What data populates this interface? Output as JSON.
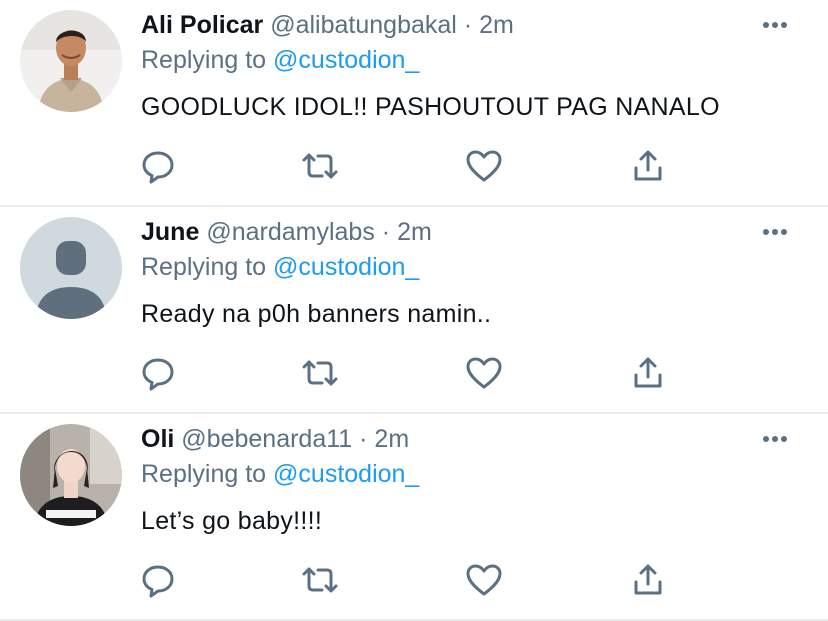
{
  "tweets": [
    {
      "name": "Ali Policar",
      "handle": "@alibatungbakal",
      "separator": "·",
      "time": "2m",
      "replying_prefix": "Replying to",
      "replying_to": "@custodion_",
      "text": "GOODLUCK IDOL!! PASHOUTOUT PAG NANALO",
      "avatar": "profile-photo-man"
    },
    {
      "name": "June",
      "handle": "@nardamylabs",
      "separator": "·",
      "time": "2m",
      "replying_prefix": "Replying to",
      "replying_to": "@custodion_",
      "text": "Ready na p0h banners namin..",
      "avatar": "default-avatar"
    },
    {
      "name": "Oli",
      "handle": "@bebenarda11",
      "separator": "·",
      "time": "2m",
      "replying_prefix": "Replying to",
      "replying_to": "@custodion_",
      "text": "Let’s go baby!!!!",
      "avatar": "profile-photo-woman"
    }
  ],
  "icons": {
    "reply": "comment-icon",
    "retweet": "retweet-icon",
    "like": "heart-icon",
    "share": "share-icon",
    "more": "more-options-icon"
  },
  "colors": {
    "icon_gray": "#5b7083",
    "link_blue": "#1d9bf0",
    "divider": "#e9ecef"
  }
}
